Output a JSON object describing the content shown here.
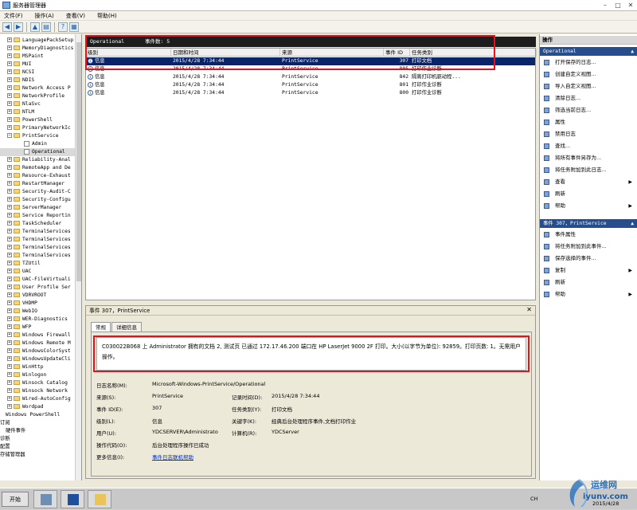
{
  "window": {
    "title": "服务器管理器"
  },
  "menu": [
    "文件(F)",
    "操作(A)",
    "查看(V)",
    "帮助(H)"
  ],
  "tree": [
    {
      "label": "LanguagePackSetup",
      "kind": "folder",
      "indent": 0
    },
    {
      "label": "MemoryDiagnostics",
      "kind": "folder",
      "indent": 0
    },
    {
      "label": "MSPaint",
      "kind": "folder",
      "indent": 0
    },
    {
      "label": "MUI",
      "kind": "folder",
      "indent": 0
    },
    {
      "label": "NCSI",
      "kind": "folder",
      "indent": 0
    },
    {
      "label": "NDIS",
      "kind": "folder",
      "indent": 0
    },
    {
      "label": "Network Access P",
      "kind": "folder",
      "indent": 0
    },
    {
      "label": "NetworkProfile",
      "kind": "folder",
      "indent": 0
    },
    {
      "label": "NlaSvc",
      "kind": "folder",
      "indent": 0
    },
    {
      "label": "NTLM",
      "kind": "folder",
      "indent": 0
    },
    {
      "label": "PowerShell",
      "kind": "folder",
      "indent": 0
    },
    {
      "label": "PrimaryNetworkIc",
      "kind": "folder",
      "indent": 0
    },
    {
      "label": "PrintService",
      "kind": "folder",
      "indent": 0,
      "open": true
    },
    {
      "label": "Admin",
      "kind": "log",
      "indent": 1
    },
    {
      "label": "Operational",
      "kind": "log",
      "indent": 1,
      "selected": true
    },
    {
      "label": "Reliability-Anal",
      "kind": "folder",
      "indent": 0
    },
    {
      "label": "RemoteApp and De",
      "kind": "folder",
      "indent": 0
    },
    {
      "label": "Resource-Exhaust",
      "kind": "folder",
      "indent": 0
    },
    {
      "label": "RestartManager",
      "kind": "folder",
      "indent": 0
    },
    {
      "label": "Security-Audit-C",
      "kind": "folder",
      "indent": 0
    },
    {
      "label": "Security-Configu",
      "kind": "folder",
      "indent": 0
    },
    {
      "label": "ServerManager",
      "kind": "folder",
      "indent": 0
    },
    {
      "label": "Service Reportin",
      "kind": "folder",
      "indent": 0
    },
    {
      "label": "TaskScheduler",
      "kind": "folder",
      "indent": 0
    },
    {
      "label": "TerminalServices",
      "kind": "folder",
      "indent": 0
    },
    {
      "label": "TerminalServices",
      "kind": "folder",
      "indent": 0
    },
    {
      "label": "TerminalServices",
      "kind": "folder",
      "indent": 0
    },
    {
      "label": "TerminalServices",
      "kind": "folder",
      "indent": 0
    },
    {
      "label": "TZUtil",
      "kind": "folder",
      "indent": 0
    },
    {
      "label": "UAC",
      "kind": "folder",
      "indent": 0
    },
    {
      "label": "UAC-FileVirtuali",
      "kind": "folder",
      "indent": 0
    },
    {
      "label": "User Profile Ser",
      "kind": "folder",
      "indent": 0
    },
    {
      "label": "VDRVROOT",
      "kind": "folder",
      "indent": 0
    },
    {
      "label": "VHDMP",
      "kind": "folder",
      "indent": 0
    },
    {
      "label": "WebIO",
      "kind": "folder",
      "indent": 0
    },
    {
      "label": "WER-Diagnostics",
      "kind": "folder",
      "indent": 0
    },
    {
      "label": "WFP",
      "kind": "folder",
      "indent": 0
    },
    {
      "label": "Windows Firewall",
      "kind": "folder",
      "indent": 0
    },
    {
      "label": "Windows Remote M",
      "kind": "folder",
      "indent": 0
    },
    {
      "label": "WindowsColorSyst",
      "kind": "folder",
      "indent": 0
    },
    {
      "label": "WindowsUpdateCli",
      "kind": "folder",
      "indent": 0
    },
    {
      "label": "WinHttp",
      "kind": "folder",
      "indent": 0
    },
    {
      "label": "Winlogon",
      "kind": "folder",
      "indent": 0
    },
    {
      "label": "Winsock Catalog",
      "kind": "folder",
      "indent": 0
    },
    {
      "label": "Winsock Network",
      "kind": "folder",
      "indent": 0
    },
    {
      "label": "Wired-AutoConfig",
      "kind": "folder",
      "indent": 0
    },
    {
      "label": "Wordpad",
      "kind": "folder",
      "indent": 0
    },
    {
      "label": "Windows PowerShell",
      "kind": "plain",
      "indent": -1
    },
    {
      "label": "订阅",
      "kind": "plain",
      "indent": -2
    },
    {
      "label": "硬件事件",
      "kind": "plain",
      "indent": -1
    },
    {
      "label": "诊断",
      "kind": "plain",
      "indent": -2
    },
    {
      "label": "配置",
      "kind": "plain",
      "indent": -2
    },
    {
      "label": "存储管理器",
      "kind": "plain",
      "indent": -2
    }
  ],
  "log": {
    "name": "Operational",
    "count_label": "事件数: 5"
  },
  "columns": [
    "级别",
    "日期和时间",
    "来源",
    "事件 ID",
    "任务类别"
  ],
  "events": [
    {
      "level": "信息",
      "datetime": "2015/4/28 7:34:44",
      "source": "PrintService",
      "id": "307",
      "task": "打印文档",
      "selected": true
    },
    {
      "level": "信息",
      "datetime": "2015/4/28 7:34:44",
      "source": "PrintService",
      "id": "805",
      "task": "打印作业诊断"
    },
    {
      "level": "信息",
      "datetime": "2015/4/28 7:34:44",
      "source": "PrintService",
      "id": "842",
      "task": "隔离打印机驱动程..."
    },
    {
      "level": "信息",
      "datetime": "2015/4/28 7:34:44",
      "source": "PrintService",
      "id": "801",
      "task": "打印作业诊断"
    },
    {
      "level": "信息",
      "datetime": "2015/4/28 7:34:44",
      "source": "PrintService",
      "id": "800",
      "task": "打印作业诊断"
    }
  ],
  "detail": {
    "title": "事件 307，PrintService",
    "tabs": [
      "常规",
      "详细信息"
    ],
    "message": "C030022B068 上 Administrator 拥有的文档 2, 测试页 已通过 172.17.46.200 端口在 HP LaserJet 9000 2F 打印。大小(以字节为单位): 92859。打印页数: 1。无需用户操作。",
    "fields": {
      "log_name_label": "日志名称(M):",
      "log_name": "Microsoft-Windows-PrintService/Operational",
      "source_label": "来源(S):",
      "source": "PrintService",
      "logged_label": "记录时间(D):",
      "logged": "2015/4/28 7:34:44",
      "event_id_label": "事件 ID(E):",
      "event_id": "307",
      "task_label": "任务类别(Y):",
      "task": "打印文档",
      "level_label": "级别(L):",
      "level": "信息",
      "keywords_label": "关键字(K):",
      "keywords": "经典后台处理程序事件,文档打印作业",
      "user_label": "用户(U):",
      "user": "YDCSERVER\\Administrato",
      "computer_label": "计算机(R):",
      "computer": "YDCServer",
      "opcode_label": "操作代码(O):",
      "opcode": "后台处理程序操作已成功",
      "more_label": "更多信息(I):",
      "more": "事件日志联机帮助"
    }
  },
  "actions": {
    "header": "操作",
    "section1": "Operational",
    "items1": [
      "打开保存的日志...",
      "创建自定义视图...",
      "导入自定义视图...",
      "清除日志...",
      "筛选当前日志...",
      "属性",
      "禁用日志",
      "查找...",
      "将所有事件另存为...",
      "将任务附加到此日志...",
      "查看",
      "刷新",
      "帮助"
    ],
    "section2": "事件 307，PrintService",
    "items2": [
      "事件属性",
      "将任务附加到此事件...",
      "保存选择的事件...",
      "复制",
      "刷新",
      "帮助"
    ]
  },
  "taskbar": {
    "start": "开始",
    "lang": "CH",
    "date": "2015/4/28"
  },
  "watermark": {
    "line1": "运维网",
    "line2": "iyunv.com"
  }
}
